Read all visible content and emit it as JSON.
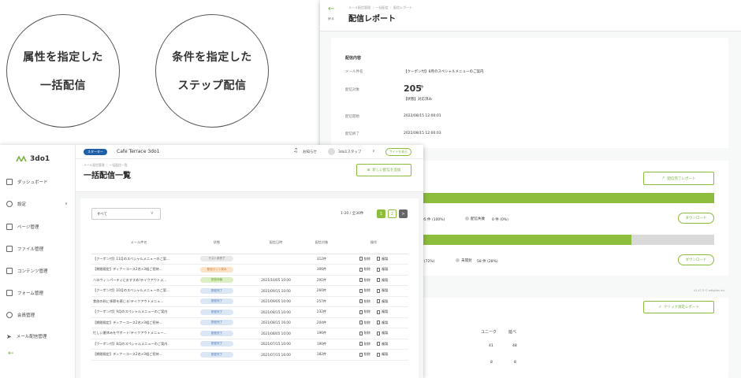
{
  "circles": [
    {
      "line1": "属性を指定した",
      "line2": "一括配信"
    },
    {
      "line1": "条件を指定した",
      "line2": "ステップ配信"
    }
  ],
  "report": {
    "back_arrow": "←",
    "back_label": "戻る",
    "breadcrumb": "メール配信管理 ｜ 一括配信 ｜ 配信レポート",
    "title": "配信レポート",
    "section_title": "配信内容",
    "fields": [
      {
        "label": "メール件名",
        "value": "【クーポン付】8月のスペシャルメニューのご案内"
      },
      {
        "label": "配信対象",
        "value": "205",
        "unit": "件",
        "note": "【状態】対応済み"
      },
      {
        "label": "配信開始",
        "value": "2022/08/15 12:00:01"
      },
      {
        "label": "配信終了",
        "value": "2022/08/15 12:00:03"
      }
    ],
    "complete_report_btn": "配信完了レポート",
    "bar1": {
      "fill": 1.0,
      "success_text": "205 件 (100%)",
      "fail_label": "配信失敗",
      "fail_text": "0 件 (0%)"
    },
    "bar2": {
      "fill": 0.72,
      "opened_text": "件 (72%)",
      "unopened_label": "未開封",
      "unopened_text": "58 件 (28%)"
    },
    "download1": "ダウンロード",
    "download2": "ダウンロード",
    "version": "v2.47.3 © edigitex Inc.",
    "click_report_btn": "クリック測定レポート",
    "click_table": {
      "headers": [
        "ユニーク",
        "延べ"
      ],
      "rows": [
        [
          "41",
          "48"
        ],
        [
          "8",
          "8"
        ]
      ]
    }
  },
  "list": {
    "logo": "3do1",
    "sidebar": [
      {
        "label": "ダッシュボード",
        "icon": "dashboard-icon"
      },
      {
        "label": "設定",
        "icon": "gear-icon",
        "chevron": "∨"
      },
      {
        "label": "ページ管理",
        "icon": "page-icon"
      },
      {
        "label": "ファイル管理",
        "icon": "file-icon"
      },
      {
        "label": "コンテンツ管理",
        "icon": "content-icon"
      },
      {
        "label": "フォーム管理",
        "icon": "form-icon"
      },
      {
        "label": "会員管理",
        "icon": "members-icon"
      },
      {
        "label": "メール配信管理",
        "icon": "send-icon"
      }
    ],
    "collapse_arrow": "←",
    "plan_badge": "スターター",
    "site_name": "Cafe Terrace 3do1",
    "notice": "お知らせ",
    "user": "3do1スタッフ",
    "user_chevron": "∨",
    "view_site": "サイトを表示",
    "breadcrumb": "メール配信管理 ｜ 一括配信一覧",
    "title": "一括配信一覧",
    "new_button": "新しい配信を追加",
    "filter": "すべて",
    "range": "1-20 / 全30件",
    "pages": [
      "1",
      "2"
    ],
    "next": ">",
    "prev": "<",
    "columns": [
      "メール件名",
      "状態",
      "配信日時",
      "配信対象",
      "操作"
    ],
    "action_delete": "削除",
    "action_copy": "複製",
    "rows": [
      {
        "subject": "【クーポン付】11月のスペシャルメニューのご案...",
        "status": "テスト未完了",
        "status_kind": "gray",
        "date": "",
        "count": "312件"
      },
      {
        "subject": "【期間限定】ディナーコース2名×3組ご招待...",
        "status": "配信セット済み",
        "status_kind": "orange",
        "date": "",
        "count": "306件"
      },
      {
        "subject": "ハロウィンパーティにおすすめ!テイクアウトメ...",
        "status": "配信待機",
        "status_kind": "green",
        "date": "2021/10/05 10:00",
        "count": "291件"
      },
      {
        "subject": "【クーポン付】10月のスペシャルメニューのご案...",
        "status": "配信完了",
        "status_kind": "blue",
        "date": "2021/09/15 10:00",
        "count": "260件"
      },
      {
        "subject": "食欲の秋に季節を感じる!テイクアウトメニュ...",
        "status": "配信完了",
        "status_kind": "blue",
        "date": "2021/09/05 10:00",
        "count": "257件"
      },
      {
        "subject": "【クーポン付】9月のスペシャルメニューのご案内",
        "status": "配信完了",
        "status_kind": "blue",
        "date": "2021/08/15 10:00",
        "count": "232件"
      },
      {
        "subject": "【期間限定】ディナーコース2名×3組ご招待...",
        "status": "配信完了",
        "status_kind": "blue",
        "date": "2021/08/15 16:00",
        "count": "204件"
      },
      {
        "subject": "忙しい夏休みをサポート!テイクアウトメニュー...",
        "status": "配信完了",
        "status_kind": "blue",
        "date": "2021/08/05 10:00",
        "count": "196件"
      },
      {
        "subject": "【クーポン付】8月のスペシャルメニューのご案内",
        "status": "配信完了",
        "status_kind": "blue",
        "date": "2021/07/15 10:00",
        "count": "190件"
      },
      {
        "subject": "【期間限定】ディナーコース2名×3組ご招待...",
        "status": "配信完了",
        "status_kind": "blue",
        "date": "2021/07/15 16:00",
        "count": "182件"
      }
    ]
  },
  "colors": {
    "accent": "#8cbd3c",
    "badge": "#1f5fa8",
    "text": "#333333"
  }
}
